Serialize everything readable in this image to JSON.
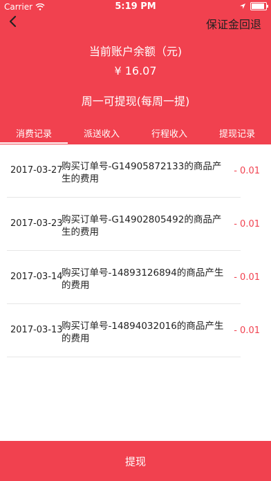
{
  "status": {
    "carrier": "Carrier",
    "time": "5:19 PM"
  },
  "nav": {
    "right_action": "保证金回退"
  },
  "balance": {
    "label": "当前账户余额（元)",
    "value": "¥ 16.07",
    "rule": "周一可提现(每周一提)"
  },
  "tabs": [
    {
      "label": "消费记录",
      "active": true
    },
    {
      "label": "派送收入",
      "active": false
    },
    {
      "label": "行程收入",
      "active": false
    },
    {
      "label": "提现记录",
      "active": false
    }
  ],
  "records": [
    {
      "date": "2017-03-27",
      "desc": "购买订单号-G14905872133的商品产生的费用",
      "amount": "- 0.01"
    },
    {
      "date": "2017-03-23",
      "desc": "购买订单号-G14902805492的商品产生的费用",
      "amount": "- 0.01"
    },
    {
      "date": "2017-03-14",
      "desc": "购买订单号-14893126894的商品产生的费用",
      "amount": "- 0.01"
    },
    {
      "date": "2017-03-13",
      "desc": "购买订单号-14894032016的商品产生的费用",
      "amount": "- 0.01"
    }
  ],
  "bottom": {
    "label": "提现"
  },
  "colors": {
    "accent": "#f1414f"
  }
}
